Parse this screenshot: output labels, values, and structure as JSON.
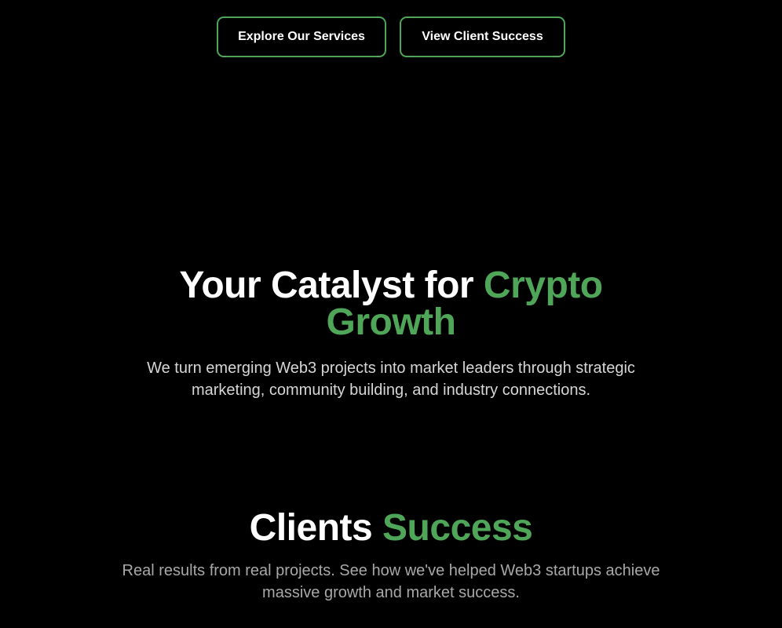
{
  "actions": {
    "services_label": "Explore Our Services",
    "clients_label": "View Client Success"
  },
  "hero": {
    "title_white": "Your Catalyst for ",
    "title_green": "Crypto Growth",
    "subtitle": "We turn emerging Web3 projects into market leaders through strategic marketing, community building, and industry connections."
  },
  "clients": {
    "title_white": "Clients ",
    "title_green": "Success",
    "subtitle": "Real results from real projects. See how we've helped Web3 startups achieve massive growth and market success."
  },
  "colors": {
    "background": "#000000",
    "accent": "#4fa659",
    "text": "#ffffff"
  }
}
